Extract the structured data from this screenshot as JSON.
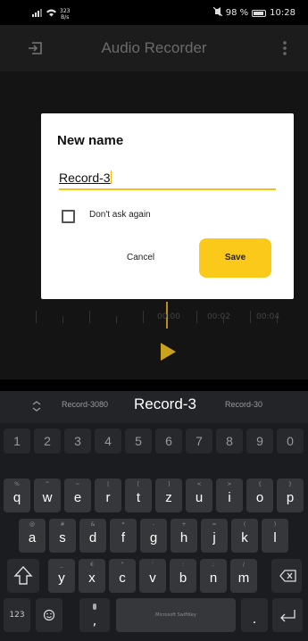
{
  "status_bar": {
    "net_speed_value": "323",
    "net_speed_unit": "B/s",
    "battery_text": "98 %",
    "time": "10:28"
  },
  "app_bar": {
    "title": "Audio Recorder",
    "left_icon": "exit-to-app-icon",
    "right_icon": "more-vert-icon"
  },
  "background": {
    "time_labels": [
      "00:00",
      "00:02",
      "00:04"
    ]
  },
  "dialog": {
    "title": "New name",
    "name_value": "Record-3",
    "checkbox_label": "Don't ask again",
    "checkbox_checked": false,
    "cancel_label": "Cancel",
    "save_label": "Save",
    "accent_color": "#fbc919"
  },
  "keyboard": {
    "suggestions": [
      "Record-3080",
      "Record-3",
      "Record-30"
    ],
    "number_row": [
      "1",
      "2",
      "3",
      "4",
      "5",
      "6",
      "7",
      "8",
      "9",
      "0"
    ],
    "row1": [
      {
        "main": "q",
        "sec": "%"
      },
      {
        "main": "w",
        "sec": "^"
      },
      {
        "main": "e",
        "sec": "~"
      },
      {
        "main": "r",
        "sec": "|"
      },
      {
        "main": "t",
        "sec": "["
      },
      {
        "main": "z",
        "sec": "]"
      },
      {
        "main": "u",
        "sec": "<"
      },
      {
        "main": "i",
        "sec": ">"
      },
      {
        "main": "o",
        "sec": "{"
      },
      {
        "main": "p",
        "sec": "}"
      }
    ],
    "row2": [
      {
        "main": "a",
        "sec": "@"
      },
      {
        "main": "s",
        "sec": "#"
      },
      {
        "main": "d",
        "sec": "&"
      },
      {
        "main": "f",
        "sec": "*"
      },
      {
        "main": "g",
        "sec": "-"
      },
      {
        "main": "h",
        "sec": "+"
      },
      {
        "main": "j",
        "sec": "="
      },
      {
        "main": "k",
        "sec": "("
      },
      {
        "main": "l",
        "sec": ")"
      }
    ],
    "row3": [
      {
        "main": "y",
        "sec": "_"
      },
      {
        "main": "x",
        "sec": "€"
      },
      {
        "main": "c",
        "sec": "\""
      },
      {
        "main": "v",
        "sec": "'"
      },
      {
        "main": "b",
        "sec": ":"
      },
      {
        "main": "n",
        "sec": ";"
      },
      {
        "main": "m",
        "sec": "/"
      }
    ],
    "num_switch_label": "123",
    "comma_label": ",",
    "period_label": ".",
    "space_label": "Microsoft SwiftKey"
  }
}
